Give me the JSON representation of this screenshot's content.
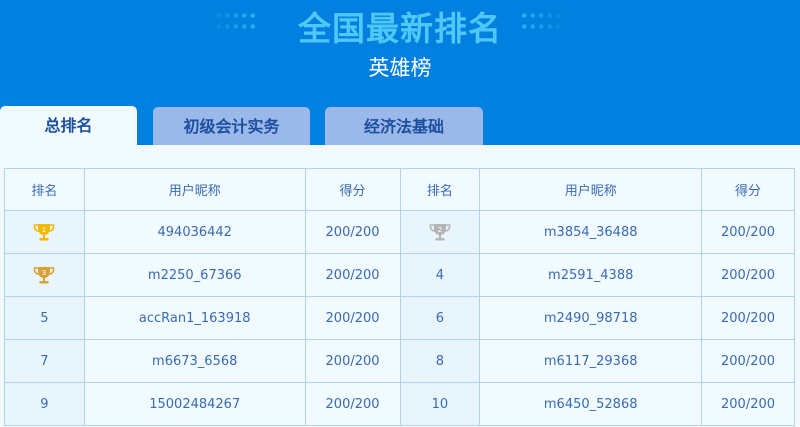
{
  "header": {
    "title": "全国最新排名",
    "subtitle": "英雄榜"
  },
  "tabs": [
    {
      "label": "总排名",
      "active": true
    },
    {
      "label": "初级会计实务",
      "active": false
    },
    {
      "label": "经济法基础",
      "active": false
    }
  ],
  "table": {
    "columns": [
      "排名",
      "用户昵称",
      "得分",
      "排名",
      "用户昵称",
      "得分"
    ],
    "rows": [
      [
        {
          "rank": "1",
          "trophy": "gold",
          "name": "494036442",
          "score": "200/200"
        },
        {
          "rank": "2",
          "trophy": "silver",
          "name": "m3854_36488",
          "score": "200/200"
        }
      ],
      [
        {
          "rank": "3",
          "trophy": "bronze",
          "name": "m2250_67366",
          "score": "200/200"
        },
        {
          "rank": "4",
          "name": "m2591_4388",
          "score": "200/200"
        }
      ],
      [
        {
          "rank": "5",
          "name": "accRan1_163918",
          "score": "200/200"
        },
        {
          "rank": "6",
          "name": "m2490_98718",
          "score": "200/200"
        }
      ],
      [
        {
          "rank": "7",
          "name": "m6673_6568",
          "score": "200/200"
        },
        {
          "rank": "8",
          "name": "m6117_29368",
          "score": "200/200"
        }
      ],
      [
        {
          "rank": "9",
          "name": "15002484267",
          "score": "200/200"
        },
        {
          "rank": "10",
          "name": "m6450_52868",
          "score": "200/200"
        }
      ]
    ]
  },
  "colors": {
    "gold": "#f5b800",
    "silver": "#b5b5b5",
    "bronze": "#d9a038"
  }
}
